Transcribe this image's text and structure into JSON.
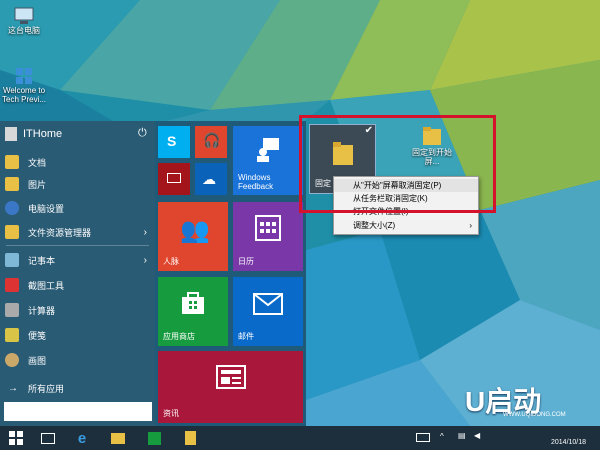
{
  "desktop": {
    "this_pc_label": "这台电脑",
    "welcome_label_line1": "Welcome to",
    "welcome_label_line2": "Tech Previ...",
    "folder_label_line1": "固定",
    "folder2_label_line1": "固定到开始",
    "folder2_label_line2": "屏..."
  },
  "start_menu": {
    "user_name": "ITHome",
    "items": [
      {
        "label": "文档",
        "icon": "documents-icon",
        "color": "#e8c045"
      },
      {
        "label": "图片",
        "icon": "pictures-icon",
        "color": "#e8c045"
      },
      {
        "label": "电脑设置",
        "icon": "gear-icon",
        "color": "#3b77c7"
      },
      {
        "label": "文件资源管理器",
        "icon": "file-explorer-icon",
        "color": "#e8c045"
      },
      {
        "label": "记事本",
        "icon": "notepad-icon",
        "color": "#7fb8d6"
      },
      {
        "label": "截图工具",
        "icon": "snipping-tool-icon",
        "color": "#d33"
      },
      {
        "label": "计算器",
        "icon": "calculator-icon",
        "color": "#aaa"
      },
      {
        "label": "便笺",
        "icon": "sticky-notes-icon",
        "color": "#d8c547"
      },
      {
        "label": "画图",
        "icon": "paint-icon",
        "color": "#c9a86a"
      },
      {
        "label": "所有应用",
        "icon": "arrow-right-icon",
        "color": ""
      }
    ],
    "tiles": {
      "skype_color": "#00aff0",
      "music_color": "#e0462e",
      "video_color": "#a4151b",
      "onedrive_color": "#0a63b8",
      "feedback_label": "Windows\nFeedback",
      "feedback_color": "#1a73d9",
      "people_label": "人脉",
      "people_color": "#e0462e",
      "calendar_label": "日历",
      "calendar_color": "#7a37a8",
      "store_label": "应用商店",
      "store_color": "#169b3e",
      "mail_label": "邮件",
      "mail_color": "#0a6ac9",
      "news_label": "资讯",
      "news_color": "#a9183a",
      "pinned_tile_label": "固定"
    }
  },
  "context_menu": {
    "items": [
      {
        "label": "从\"开始\"屏幕取消固定(P)"
      },
      {
        "label": "从任务栏取消固定(K)"
      },
      {
        "label": "打开文件位置(I)"
      },
      {
        "label": "调整大小(Z)"
      }
    ]
  },
  "taskbar": {
    "time": "",
    "date": "2014/10/18",
    "watermark_text": "U启动",
    "watermark_url": "WWW.UQIDONG.COM"
  }
}
